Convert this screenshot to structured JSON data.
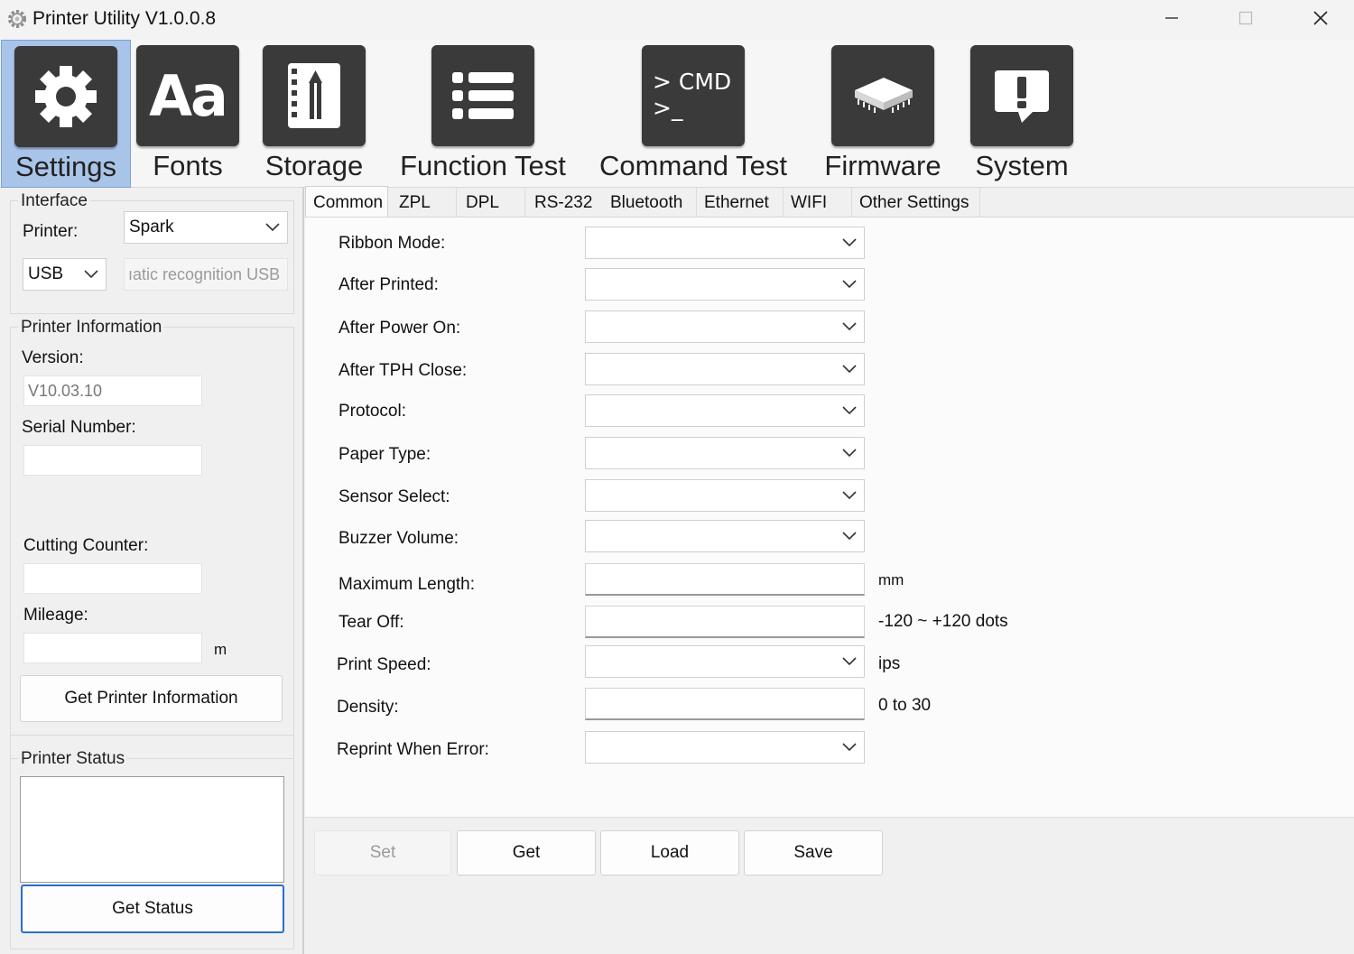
{
  "window": {
    "title": "Printer Utility  V1.0.0.8",
    "minimize": "—",
    "maximize": "☐",
    "close": "✕"
  },
  "toolbar": [
    {
      "label": "Settings",
      "icon": "gear-icon",
      "active": true
    },
    {
      "label": "Fonts",
      "icon": "fonts-icon",
      "glyph": "Aa"
    },
    {
      "label": "Storage",
      "icon": "storage-icon"
    },
    {
      "label": "Function Test",
      "icon": "list-icon"
    },
    {
      "label": "Command Test",
      "icon": "cmd-icon",
      "glyph1": "> CMD",
      "glyph2": ">_"
    },
    {
      "label": "Firmware",
      "icon": "chip-icon"
    },
    {
      "label": "System",
      "icon": "alert-icon"
    }
  ],
  "interface": {
    "title": "Interface",
    "printer_label": "Printer:",
    "printer_value": "Spark",
    "port_value": "USB",
    "port_detail": "ıatic recognition USB"
  },
  "info": {
    "title": "Printer Information",
    "version_label": "Version:",
    "version_value": "V10.03.10",
    "serial_label": "Serial Number:",
    "serial_value": "",
    "cutting_label": "Cutting Counter:",
    "cutting_value": "",
    "mileage_label": "Mileage:",
    "mileage_value": "",
    "mileage_unit": "m",
    "get_info_button": "Get Printer Information"
  },
  "status": {
    "title": "Printer Status",
    "value": "",
    "get_status_button": "Get Status"
  },
  "tabs": [
    "Common",
    "ZPL",
    "DPL",
    "RS-232",
    "Bluetooth",
    "Ethernet",
    "WIFI",
    "Other Settings"
  ],
  "active_tab": "Common",
  "settings": [
    {
      "label": "Ribbon Mode:",
      "kind": "select",
      "unit": ""
    },
    {
      "label": "After Printed:",
      "kind": "select",
      "unit": ""
    },
    {
      "label": "After Power On:",
      "kind": "select",
      "unit": ""
    },
    {
      "label": "After TPH Close:",
      "kind": "select",
      "unit": ""
    },
    {
      "label": "Protocol:",
      "kind": "select",
      "unit": ""
    },
    {
      "label": "Paper Type:",
      "kind": "select",
      "unit": ""
    },
    {
      "label": "Sensor Select:",
      "kind": "select",
      "unit": ""
    },
    {
      "label": "Buzzer Volume:",
      "kind": "select",
      "unit": ""
    },
    {
      "label": "Maximum Length:",
      "kind": "input",
      "unit": "mm"
    },
    {
      "label": "Tear Off:",
      "kind": "input",
      "unit": "-120 ~ +120 dots"
    },
    {
      "label": "Print Speed:",
      "kind": "select",
      "unit": "ips"
    },
    {
      "label": "Density:",
      "kind": "input",
      "unit": "0 to 30"
    },
    {
      "label": "Reprint When Error:",
      "kind": "select",
      "unit": ""
    }
  ],
  "actions": {
    "set": "Set",
    "get": "Get",
    "load": "Load",
    "save": "Save"
  }
}
